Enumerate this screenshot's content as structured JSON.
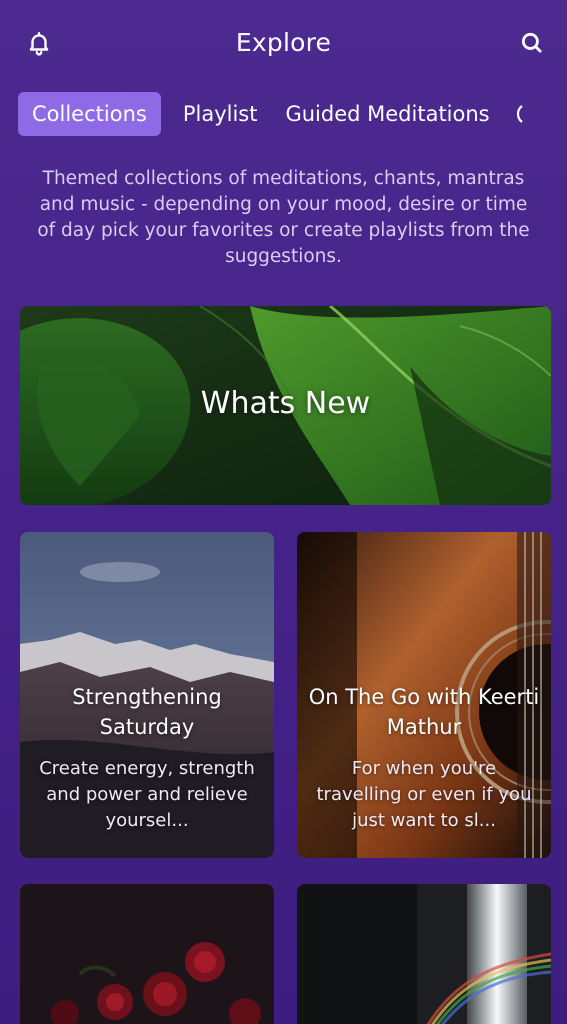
{
  "header": {
    "title": "Explore",
    "left_icon": "bell-icon",
    "right_icon": "search-icon"
  },
  "tabs": [
    {
      "label": "Collections",
      "active": true
    },
    {
      "label": "Playlist",
      "active": false
    },
    {
      "label": "Guided Meditations",
      "active": false
    }
  ],
  "description": "Themed collections of meditations, chants, mantras and music - depending on your mood, desire or time of day pick your favorites or create playlists from the suggestions.",
  "featured": {
    "title": "Whats New"
  },
  "collections": [
    {
      "title": "Strengthening Saturday",
      "subtitle": "Create energy, strength and power and relieve yoursel..."
    },
    {
      "title": "On The Go with Keerti Mathur",
      "subtitle": "For when you're travelling or even if you just want to sl..."
    }
  ],
  "colors": {
    "background": "#4a2589",
    "active_tab": "#8f6ae6",
    "description_text": "#d9cdf2"
  }
}
